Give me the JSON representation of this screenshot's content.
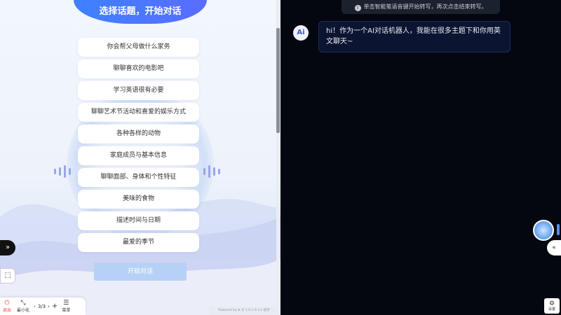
{
  "left_panel": {
    "title": "选择话题，开始对话",
    "topics": [
      "你会帮父母做什么家务",
      "聊聊喜欢的电影吧",
      "学习英语很有必要",
      "聊聊艺术节活动和喜爱的娱乐方式",
      "各种各样的动物",
      "家庭成员与基本信息",
      "聊聊面部、身体和个性特征",
      "美味的食物",
      "描述时间与日期",
      "最爱的季节"
    ],
    "start_button": "开始对话",
    "powered_by": "Powered by ⊕ 文 1.0.1 0.3.1 提示"
  },
  "toolbar": {
    "exit_label": "退出",
    "minimize_label": "最小化",
    "page": "3/3",
    "menu_label": "菜单"
  },
  "right_panel": {
    "hint": "单击智能笔语音键开始转写，再次点击结束转写。",
    "avatar": "Ai",
    "message": "hi！作为一个AI对话机器人，我能在很多主题下和你用英文聊天~",
    "settings_label": "设置"
  },
  "colors": {
    "accent": "#3e82ff",
    "start_button": "#b7d1f6",
    "right_bg": "#04070f",
    "bubble_bg": "#0b1430"
  }
}
